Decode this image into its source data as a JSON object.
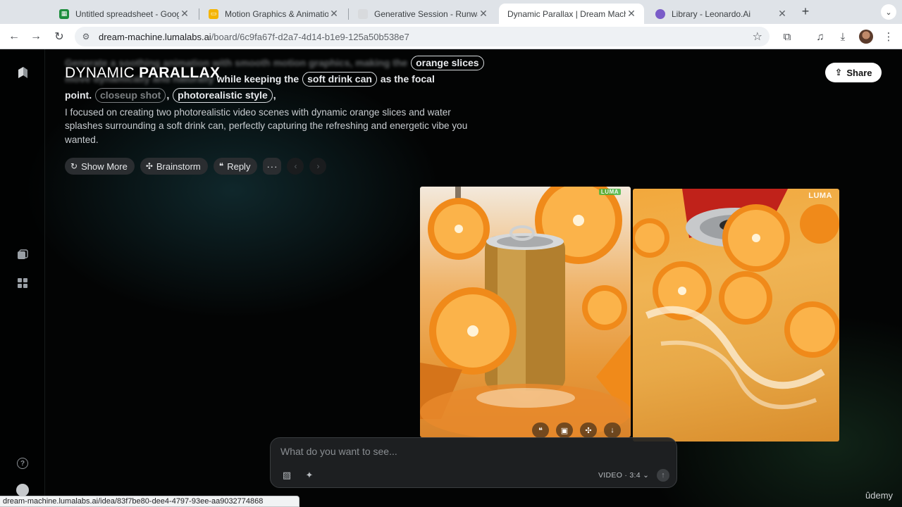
{
  "browser": {
    "tabs": [
      {
        "title": "Untitled spreadsheet - Google Sheets",
        "favicon": "sheets-icon",
        "color": "#1e8e3e",
        "active": false
      },
      {
        "title": "Motion Graphics & Animation",
        "favicon": "slides-icon",
        "color": "#f4b400",
        "active": false
      },
      {
        "title": "Generative Session - Runway",
        "favicon": "runway-icon",
        "color": "#d8dadd",
        "active": false
      },
      {
        "title": "Dynamic Parallax | Dream Machine",
        "favicon": "luma-icon",
        "color": "#ffffff",
        "active": true
      },
      {
        "title": "Library - Leonardo.Ai",
        "favicon": "leonardo-icon",
        "color": "#7a5cc8",
        "active": false
      }
    ],
    "url_host": "dream-machine.lumalabs.ai",
    "url_path": "/board/6c9fa67f-d2a7-4d14-b1e9-125a50b538e7",
    "status_url": "dream-machine.lumalabs.ai/idea/83f7be80-dee4-4797-93ee-aa9032774868"
  },
  "board": {
    "title_light": "DYNAMIC",
    "title_bold": "PARALLAX",
    "share_label": "Share"
  },
  "prompt": {
    "line1_blur": "Generate a soothing animation with smooth motion graphics, making the",
    "line1_tail": "",
    "chip_orange": "orange slices",
    "line2_blur": "move dynamically and naturally",
    "line2_mid": "while keeping the",
    "chip_can": "soft drink can",
    "line2_tail": "as the focal",
    "line3_head": "point.",
    "chip_closeup": "closeup shot",
    "chip_photo": "photorealistic style"
  },
  "reply": {
    "text": "I focused on creating two photorealistic video scenes with dynamic orange slices and water splashes surrounding a soft drink can, perfectly capturing the refreshing and energetic vibe you wanted."
  },
  "actions": {
    "show_more": "Show More",
    "brainstorm": "Brainstorm",
    "reply": "Reply"
  },
  "media": {
    "watermark": "LUMA"
  },
  "composer": {
    "placeholder": "What do you want to see...",
    "mode": "VIDEO · 3:4"
  },
  "footer": {
    "brand": "ûdemy"
  }
}
